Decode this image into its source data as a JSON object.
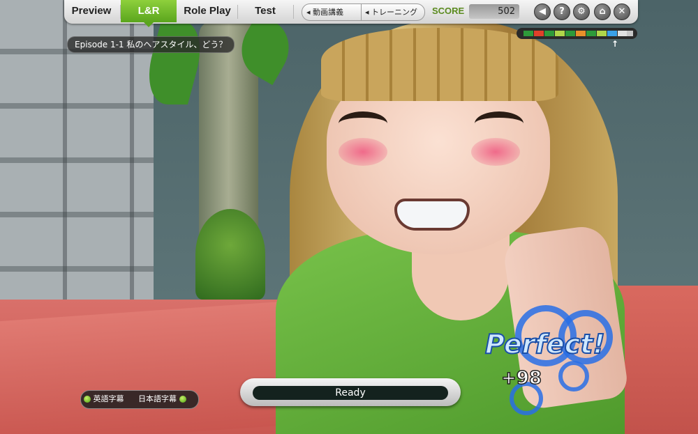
{
  "tabs": [
    {
      "label": "Preview",
      "active": false
    },
    {
      "label": "L&R",
      "active": true
    },
    {
      "label": "Role Play",
      "active": false
    },
    {
      "label": "Test",
      "active": false
    }
  ],
  "mode_switch": {
    "video_label": "動画講義",
    "training_label": "トレーニング"
  },
  "score": {
    "label": "SCORE",
    "value": "502"
  },
  "icons": [
    "back-icon",
    "help-icon",
    "gear-icon",
    "home-icon",
    "close-icon"
  ],
  "icon_glyphs": {
    "back": "◀",
    "help": "?",
    "settings": "⚙",
    "home": "⌂",
    "close": "✕"
  },
  "episode_title": "Episode 1-1 私のヘアスタイル、どう？",
  "progress_meter": {
    "segments": [
      "#2e9a3a",
      "#e0402a",
      "#2e9a3a",
      "#b0d64a",
      "#2e9a3a",
      "#e8902a",
      "#2e9a3a",
      "#b0d64a",
      "#3aa0e8",
      "#e0e0e0",
      "#c8c8c8"
    ],
    "arrow": "↑"
  },
  "subtitles": {
    "english_label": "英語字幕",
    "japanese_label": "日本語字幕"
  },
  "status_bar": {
    "text": "Ready"
  },
  "feedback": {
    "rating": "Perfect!",
    "points": "+98"
  },
  "colors": {
    "accent_green": "#5aa51d",
    "ring_blue": "#286ee6"
  }
}
